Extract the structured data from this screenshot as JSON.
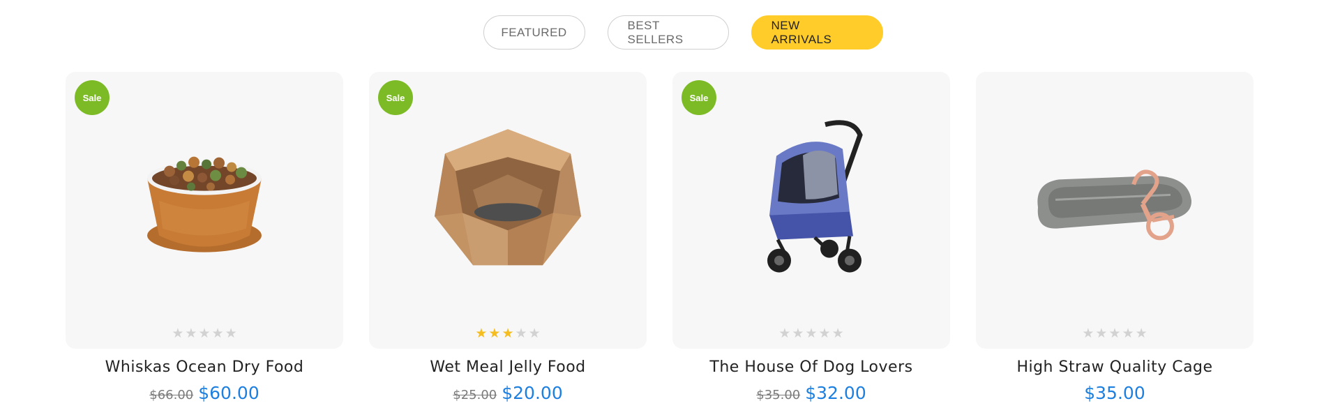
{
  "tabs": [
    {
      "label": "FEATURED",
      "active": false
    },
    {
      "label": "BEST SELLERS",
      "active": false
    },
    {
      "label": "NEW ARRIVALS",
      "active": true
    }
  ],
  "colors": {
    "accent_tab": "#ffcc29",
    "sale_badge": "#7cbb26",
    "price": "#1d7fe0",
    "star_filled": "#f5bd1f",
    "star_empty": "#d2d2d2"
  },
  "products": [
    {
      "title": "Whiskas Ocean Dry Food",
      "badge": "Sale",
      "rating": 0,
      "old_price": "$66.00",
      "price": "$60.00",
      "image": "pet-food-bowl"
    },
    {
      "title": "Wet Meal Jelly Food",
      "badge": "Sale",
      "rating": 3,
      "old_price": "$25.00",
      "price": "$20.00",
      "image": "wooden-pet-bed"
    },
    {
      "title": "The House Of Dog Lovers",
      "badge": "Sale",
      "rating": 0,
      "old_price": "$35.00",
      "price": "$32.00",
      "image": "pet-stroller"
    },
    {
      "title": "High Straw Quality Cage",
      "badge": "",
      "rating": 0,
      "old_price": "",
      "price": "$35.00",
      "image": "dog-leash"
    }
  ]
}
